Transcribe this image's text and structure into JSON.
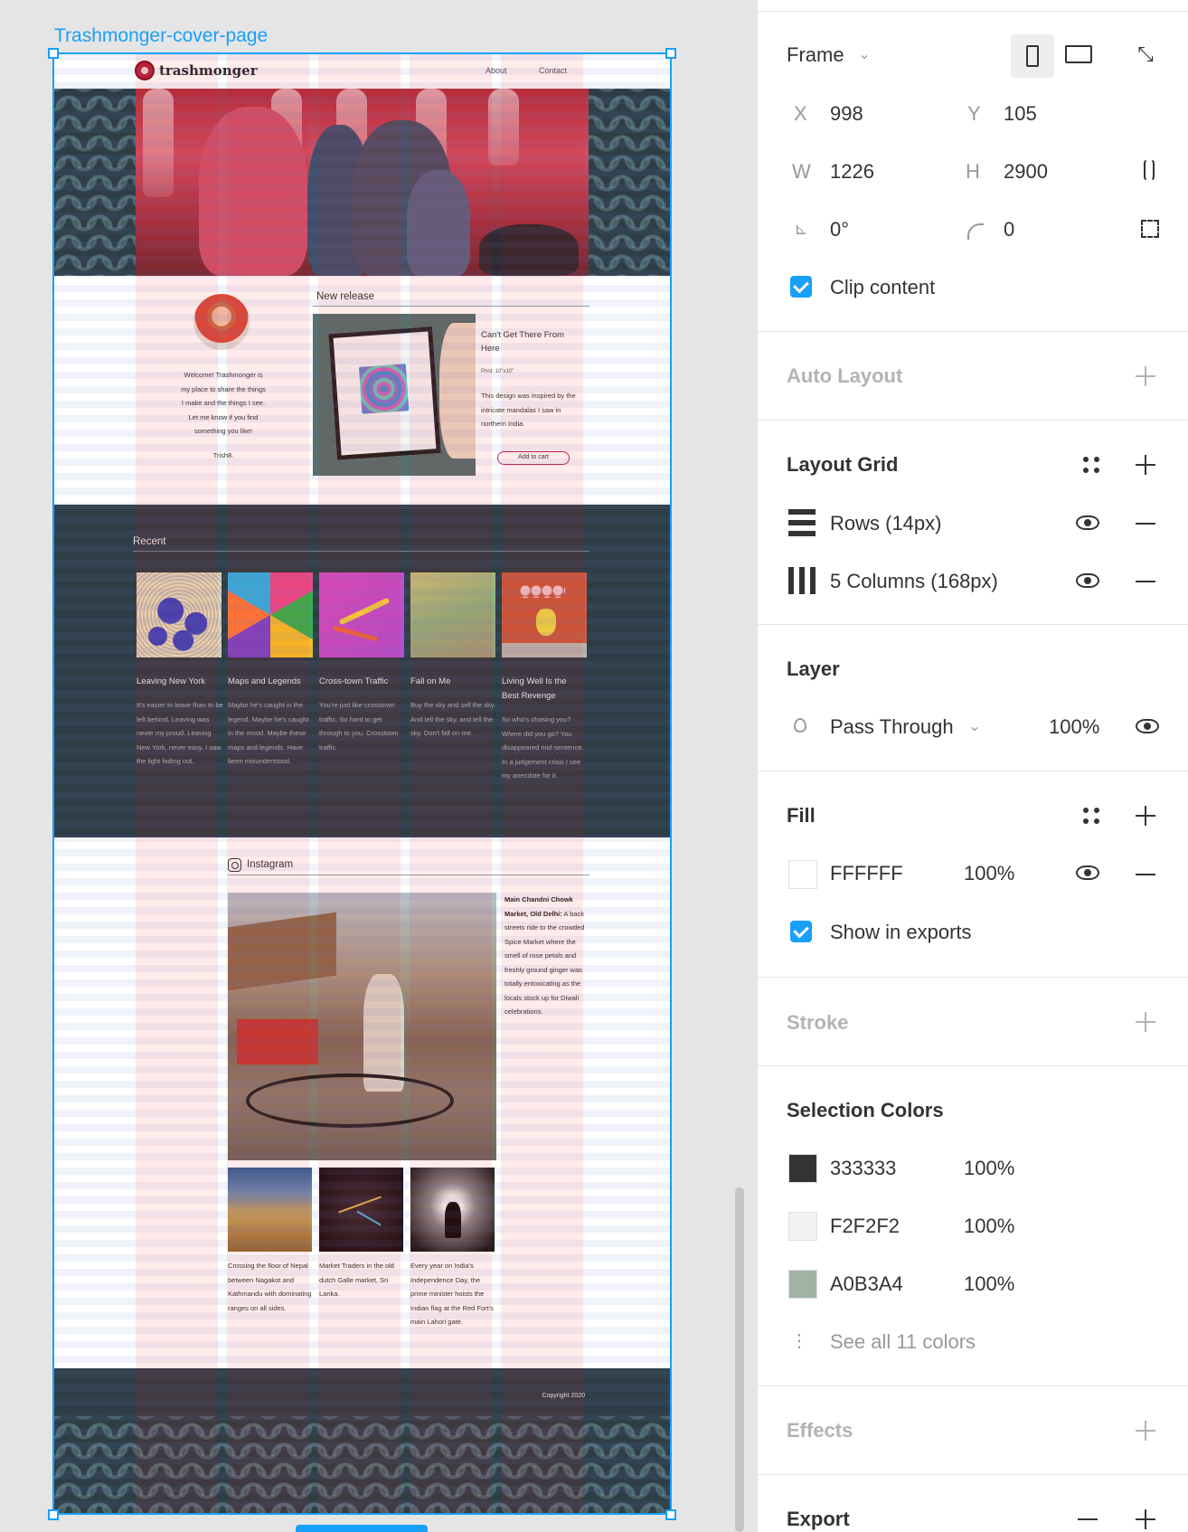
{
  "canvas": {
    "frame_name": "Trashmonger-cover-page"
  },
  "site": {
    "logo_text": "trashmonger",
    "nav": [
      "About",
      "Contact"
    ],
    "welcome_lines": [
      "Welcome! Trashmonger is",
      "my place to share the things",
      "I make and the things I see.",
      "Let me know if you find",
      "something you like!"
    ],
    "signoff": "Trish8.",
    "new_release": {
      "heading": "New release",
      "title": "Can't Get There From Here",
      "print": "Print: 10\"x10\"",
      "description": "This design was inspired by the intricate mandalas I saw in northern India.",
      "button": "Add to cart"
    },
    "recent": {
      "heading": "Recent",
      "items": [
        {
          "title": "Leaving New York",
          "desc": "It's easier to leave than to be left behind. Leaving was never my proud. Leaving New York, never easy. I saw the light fading out."
        },
        {
          "title": "Maps and Legends",
          "desc": "Maybe he's caught in the legend. Maybe he's caught in the mood. Maybe these maps and legends. Have been misunderstood."
        },
        {
          "title": "Cross-town Traffic",
          "desc": "You're just like crosstown traffic. So hard to get through to you. Crosstown traffic"
        },
        {
          "title": "Fall on Me",
          "desc": "Buy the sky and sell the sky. And tell the sky. and tell the sky. Don't fall on me."
        },
        {
          "title": "Living Well Is the Best Revenge",
          "desc": "So who's chasing you? Where did you go? You disappeared mid-sentence. In a judgement crisis I see my anecdote for it."
        }
      ]
    },
    "instagram": {
      "heading": "Instagram",
      "main_caption_bold": "Main Chandni Chowk Market, Old Delhi:",
      "main_caption": " A back streets ride to the crowded Spice Market where the smell of rose petals and freshly ground ginger was totally entoxicating as the locals stock up for Diwali celebrations.",
      "thumbs": [
        "Crossing the floor of Nepal between Nagakot and Kathmandu with dominating ranges on all sides.",
        "Market Traders in the old dutch Galle market, Sri Lanka.",
        "Every year on India's Independence Day, the prime minister hoists the Indian flag at the Red Fort's main Lahori gate."
      ]
    },
    "copyright": "Copyright 2020"
  },
  "panel": {
    "frame_dropdown": "Frame",
    "x_label": "X",
    "x_value": "998",
    "y_label": "Y",
    "y_value": "105",
    "w_label": "W",
    "w_value": "1226",
    "h_label": "H",
    "h_value": "2900",
    "rotation_value": "0°",
    "radius_value": "0",
    "clip_content": "Clip content",
    "clip_content_checked": true,
    "auto_layout": "Auto Layout",
    "layout_grid": "Layout Grid",
    "grid_rows": "Rows (14px)",
    "grid_columns": "5 Columns (168px)",
    "layer": "Layer",
    "blend_mode": "Pass Through",
    "layer_opacity": "100%",
    "fill": "Fill",
    "fill_hex": "FFFFFF",
    "fill_opacity": "100%",
    "show_in_exports": "Show in exports",
    "show_in_exports_checked": true,
    "stroke": "Stroke",
    "selection_colors": "Selection Colors",
    "colors": [
      {
        "hex": "333333",
        "opacity": "100%",
        "swatch": "#333333"
      },
      {
        "hex": "F2F2F2",
        "opacity": "100%",
        "swatch": "#F2F2F2"
      },
      {
        "hex": "A0B3A4",
        "opacity": "100%",
        "swatch": "#A0B3A4"
      }
    ],
    "see_all_colors": "See all 11 colors",
    "effects": "Effects",
    "export": "Export"
  },
  "colors": {
    "accent": "#18a0fb",
    "dark_band": "#2f3e46"
  }
}
